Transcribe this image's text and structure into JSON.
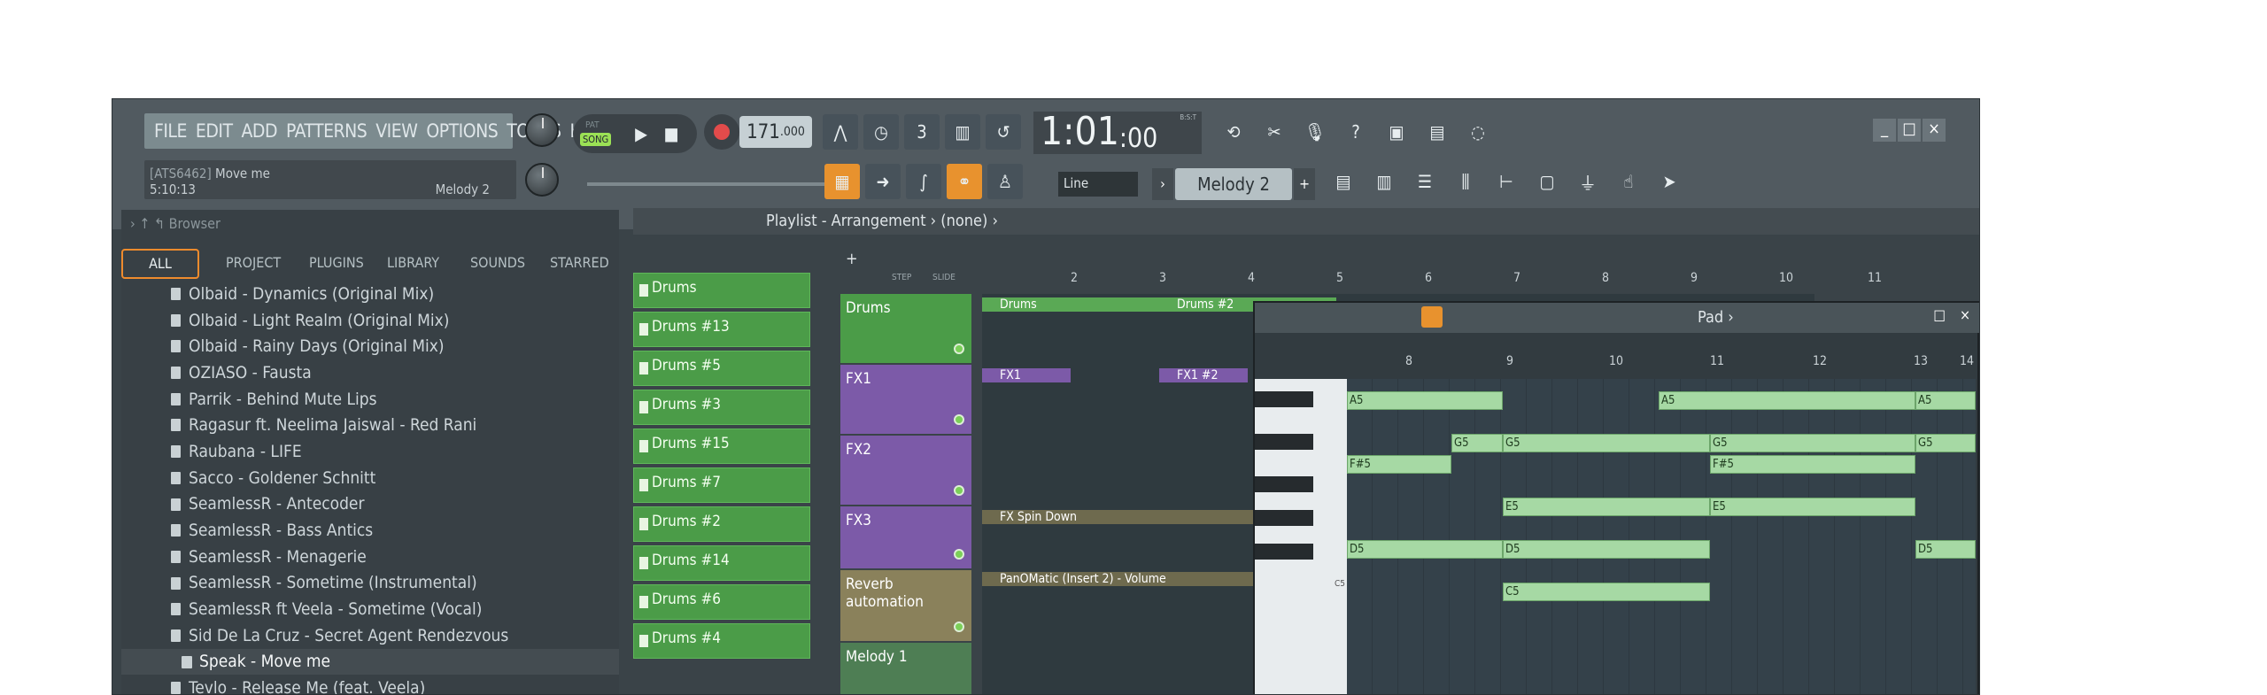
{
  "menu": [
    "FILE",
    "EDIT",
    "ADD",
    "PATTERNS",
    "VIEW",
    "OPTIONS",
    "TOOLS",
    "HELP"
  ],
  "hint": {
    "id": "[ATS6462]",
    "title": "Move me",
    "time": "5:10:13",
    "pattern": "Melody 2"
  },
  "transport": {
    "pat": "PAT",
    "song": "SONG",
    "tempo": "171",
    "tempo_frac": ".000",
    "clock": "1:01",
    "clock_sub": ":00",
    "bst": "B:S:T"
  },
  "snap": "Line",
  "pattern_sel": "Melody 2",
  "browser": {
    "title": "Browser",
    "tabs": [
      "ALL",
      "PROJECT",
      "PLUGINS",
      "LIBRARY",
      "SOUNDS",
      "STARRED"
    ],
    "items": [
      "Olbaid - Dynamics (Original Mix)",
      "Olbaid - Light Realm (Original Mix)",
      "Olbaid - Rainy Days (Original Mix)",
      "OZIASO - Fausta",
      "Parrik - Behind Mute Lips",
      "Ragasur ft. Neelima Jaiswal - Red Rani",
      "Raubana - LIFE",
      "Sacco - Goldener Schnitt",
      "SeamlessR - Antecoder",
      "SeamlessR - Bass Antics",
      "SeamlessR - Menagerie",
      "SeamlessR - Sometime (Instrumental)",
      "SeamlessR ft Veela - Sometime (Vocal)",
      "Sid De La Cruz - Secret Agent Rendezvous",
      "Speak - Move me",
      "Tevlo - Release Me (feat. Veela)"
    ]
  },
  "playlist": {
    "title": "Playlist - Arrangement › (none) ›",
    "patterns": [
      "Drums",
      "Drums #13",
      "Drums #5",
      "Drums #3",
      "Drums #15",
      "Drums #7",
      "Drums #2",
      "Drums #14",
      "Drums #6",
      "Drums #4"
    ],
    "tracks": [
      "Drums",
      "FX1",
      "FX2",
      "FX3",
      "Reverb automation",
      "Melody 1"
    ],
    "clips": [
      "Drums",
      "Drums #2",
      "FX1",
      "FX1 #2",
      "FX Spin Down",
      "PanOMatic (Insert 2) - Volume"
    ],
    "ruler": [
      "2",
      "3",
      "4",
      "5",
      "6",
      "7",
      "8",
      "9",
      "10",
      "11"
    ],
    "step": "STEP",
    "slide": "SLIDE"
  },
  "pianoroll": {
    "title": "Pad ›",
    "ruler": [
      "8",
      "9",
      "10",
      "11",
      "12",
      "13",
      "14"
    ],
    "c5": "C5",
    "notes": [
      "A5",
      "A5",
      "A5",
      "G5",
      "G5",
      "G5",
      "G5",
      "F#5",
      "F#5",
      "E5",
      "E5",
      "D5",
      "D5",
      "D5",
      "C5"
    ]
  },
  "colors": {
    "accent": "#ef8b2d",
    "green": "#4b9c48",
    "purple": "#7c5aa8"
  }
}
